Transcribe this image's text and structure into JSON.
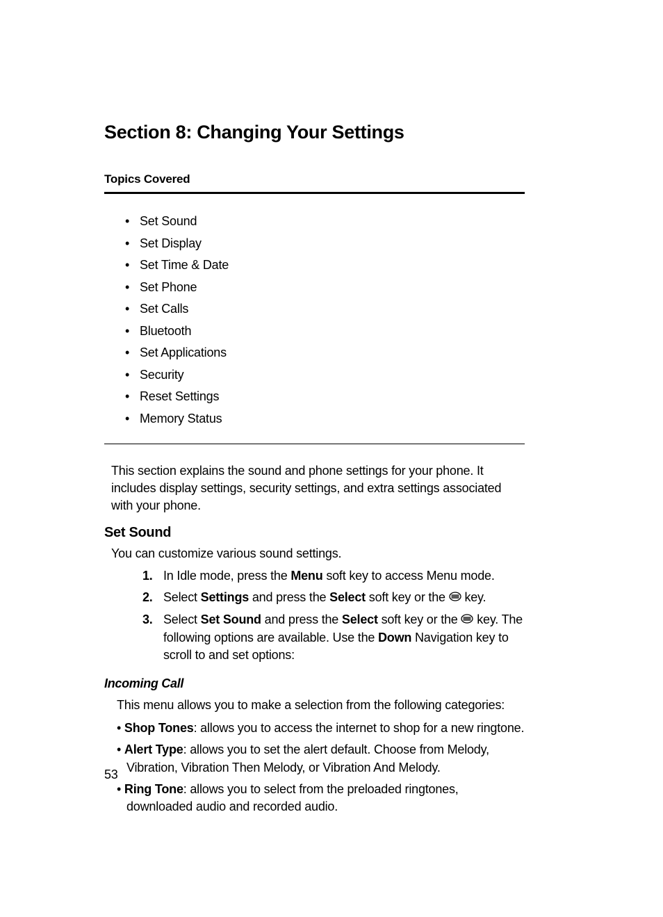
{
  "sectionTitle": "Section 8: Changing Your Settings",
  "topicsHeading": "Topics Covered",
  "topics": [
    "Set Sound",
    "Set Display",
    "Set Time & Date",
    "Set Phone",
    "Set Calls",
    "Bluetooth",
    "Set Applications",
    "Security",
    "Reset Settings",
    "Memory Status"
  ],
  "introPara": "This section explains the sound and phone settings for your phone. It includes display settings, security settings, and extra settings associated with your phone.",
  "setSound": {
    "title": "Set Sound",
    "intro": "You can customize various sound settings.",
    "steps": {
      "s1": {
        "num": "1.",
        "pre": "In Idle mode, press the ",
        "b1": "Menu",
        "post": " soft key to access Menu mode."
      },
      "s2": {
        "num": "2.",
        "pre": "Select ",
        "b1": "Settings",
        "mid1": " and press the ",
        "b2": "Select",
        "mid2": " soft key or the ",
        "post": " key."
      },
      "s3": {
        "num": "3.",
        "pre": "Select ",
        "b1": "Set Sound",
        "mid1": " and press the ",
        "b2": "Select",
        "mid2": " soft key or the ",
        "mid3": " key. The following options are available. Use the ",
        "b3": "Down",
        "post": " Navigation key to scroll to and set options:"
      }
    }
  },
  "incomingCall": {
    "title": "Incoming Call",
    "intro": "This menu allows you to make a selection from the following categories:",
    "items": {
      "i1": {
        "label": "Shop Tones",
        "desc": ": allows you to access the internet to shop for a new ringtone."
      },
      "i2": {
        "label": "Alert Type",
        "desc": ": allows you to set the alert default. Choose from Melody, Vibration, Vibration Then Melody, or Vibration And Melody."
      },
      "i3": {
        "label": "Ring Tone",
        "desc": ": allows you to select from the preloaded ringtones, downloaded audio and recorded audio."
      }
    }
  },
  "pageNumber": "53"
}
